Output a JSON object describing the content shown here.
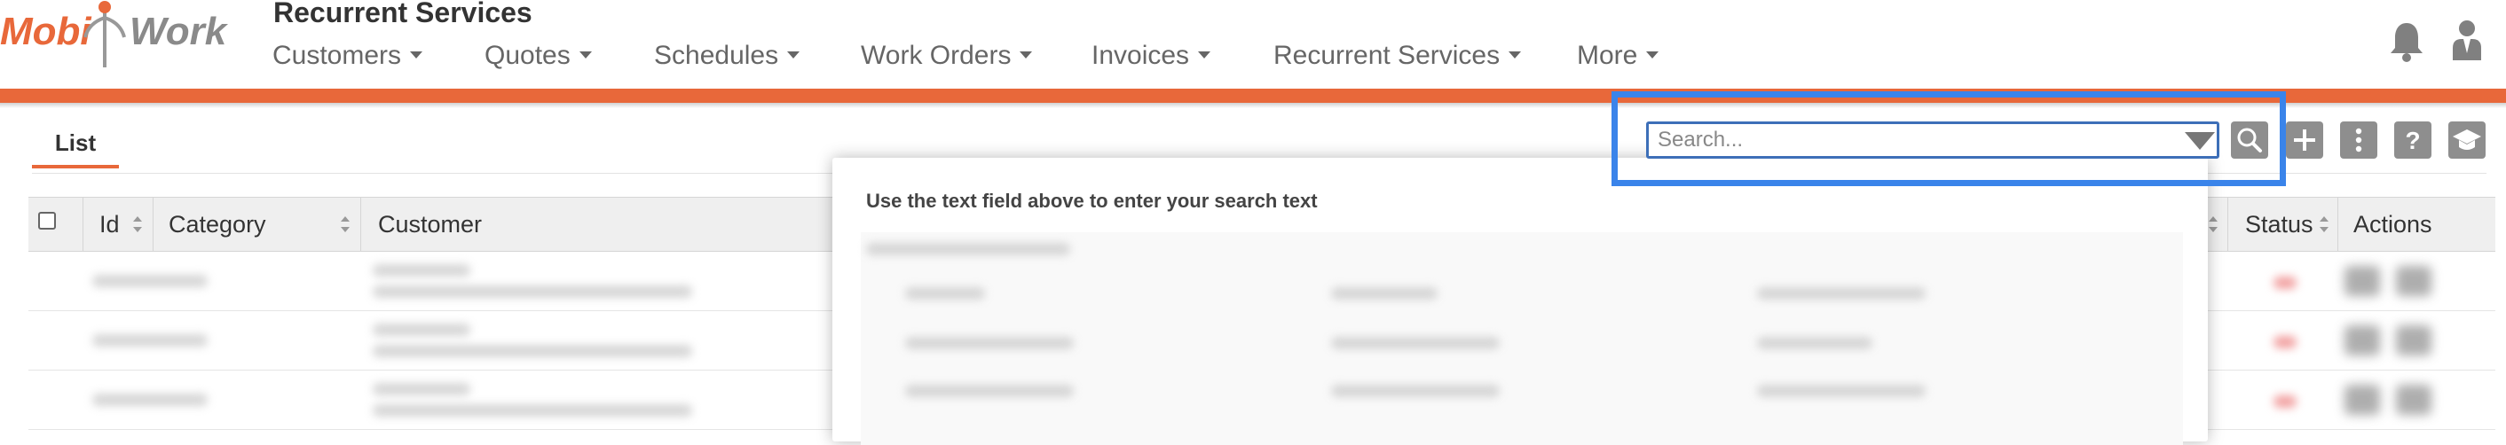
{
  "app": {
    "logo_text_left": "Mobi",
    "logo_text_right": "Work",
    "page_title": "Recurrent Services"
  },
  "nav": [
    {
      "label": "Customers"
    },
    {
      "label": "Quotes"
    },
    {
      "label": "Schedules"
    },
    {
      "label": "Work Orders"
    },
    {
      "label": "Invoices"
    },
    {
      "label": "Recurrent Services"
    },
    {
      "label": "More"
    }
  ],
  "icons": {
    "notifications": "bell-icon",
    "user": "user-icon",
    "search": "search-icon",
    "add": "plus-icon",
    "menu": "kebab-menu-icon",
    "help": "question-icon",
    "tutorial": "graduation-cap-icon"
  },
  "colors": {
    "accent": "#e8683a",
    "highlight": "#3a84ea",
    "input_border": "#3d6fb8",
    "button_gray": "#8e8e8e"
  },
  "tabs": [
    {
      "label": "List",
      "active": true
    }
  ],
  "search": {
    "placeholder": "Search...",
    "value": "",
    "panel_instruction": "Use the text field above to enter your search text"
  },
  "table": {
    "columns": [
      {
        "label": "",
        "type": "checkbox"
      },
      {
        "label": "Id",
        "sortable": true
      },
      {
        "label": "Category",
        "sortable": true
      },
      {
        "label": "Customer",
        "sortable": false
      },
      {
        "label": "Status",
        "sortable": true
      },
      {
        "label": "Actions",
        "sortable": false
      }
    ],
    "visible_rows": 3
  }
}
